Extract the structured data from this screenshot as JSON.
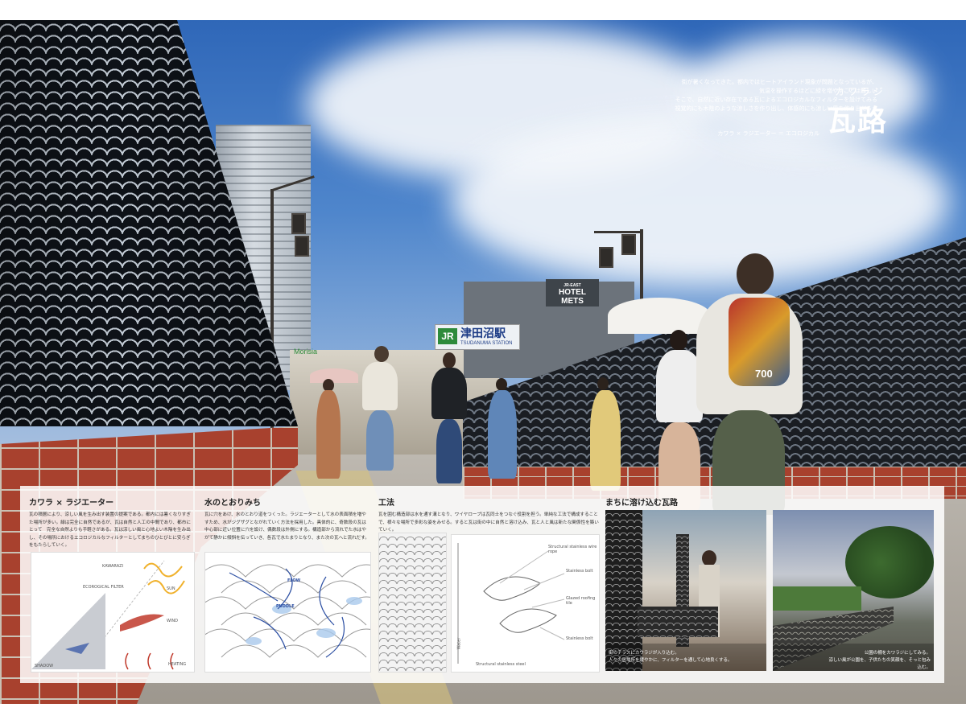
{
  "hero": {
    "intro_lines": [
      "街が暑くなってきた。都内ではヒートアイランド現象が問題となっているが、",
      "気温を操作するほどに緑を増やすことは難しい",
      "そこで、自然に近い存在である瓦によるエコロジカルなフィルターを設けてみる",
      "視覚的にも木陰のような涼しさを作り出し、体感的にも涼しい風を作り出だろう"
    ],
    "formula": "カワラ × ラジエーター ＝ エコロジカル",
    "title_ruby": "カワラジ",
    "title": "瓦路"
  },
  "signs": {
    "hotel_line1": "JR-EAST",
    "hotel_line2": "HOTEL",
    "hotel_line3": "METS",
    "jr_logo": "JR",
    "station_name": "津田沼駅",
    "station_romaji": "TSUDANUMA STATION",
    "store": "Morisia",
    "bag_number": "700"
  },
  "sections": {
    "s1": {
      "heading": "カワラ × ラジエーター",
      "body": "瓦の積層により、涼しい風を生み出す装置の提案である。都内には暑くなりすぎた場所が多い。緑は完全に自然であるが、瓦は自然と人工の中間であり、都市にとって　完全な自然よりも手軽さがある。瓦は涼しい風と心地よい木陰を生み出し、その場所におけるエコロジカルなフィルターとしてまちのひとびとに安らぎをもたらしていく。",
      "labels": {
        "kawarazi": "KAWARAZI",
        "filter": "ECOROGICAL FILTER",
        "sun": "SUN",
        "wind": "WIND",
        "shadow": "SHADOW",
        "heating": "HEATING"
      }
    },
    "s2": {
      "heading": "水のとおりみち",
      "body": "瓦に穴をあけ、水のとおり道をつくった。ラジエーターとして水の表面積を増やすため、水がジグザグとながれていく方法を採用した。具体的に、奇数段の瓦は中心部に近い位置に穴を設け、偶数段は外側にする。構造部から流れでた水はやがて静かに傾斜を伝っていき、各瓦で水たまりとなり、また次の瓦へと流れだす。",
      "labels": {
        "flow": "FLOW",
        "puddle": "PUDDLE"
      }
    },
    "s3": {
      "heading": "工法",
      "body": "瓦を囲む構造部は水を通す溝となり、ワイヤロープは瓦同士をつなぐ役割を担う。単純な工法で構成することで、様々な場所で多彩な姿をみせる。すると瓦は街の中に自然と溶け込み、瓦と人と風は新たな関係性を築いていく。",
      "labels": {
        "wire_rope": "Structural stainless wire rope",
        "bolt1": "Stainless bolt",
        "tile": "Glazed roofing tile",
        "bolt2": "Stainless bolt",
        "steel": "Structural stainless steel",
        "water": "Water"
      }
    },
    "s4": {
      "heading": "まちに溶け込む瓦路",
      "caption1_line1": "街のテラスにカワラジが入り込む。",
      "caption1_line2": "人々の居場所を緩やかに、フィルターを通して心地良くする。",
      "caption2_line1": "公園の柵をカワラジにしてみる。",
      "caption2_line2": "涼しい風が公園を、子供たちの笑顔を、そっと包み込む。"
    }
  },
  "colors": {
    "brick": "#a8412e",
    "sky": "#2f67b8",
    "panel": "#ffffff",
    "accent_blue": "#2c4fa3",
    "accent_red": "#c0392b"
  }
}
